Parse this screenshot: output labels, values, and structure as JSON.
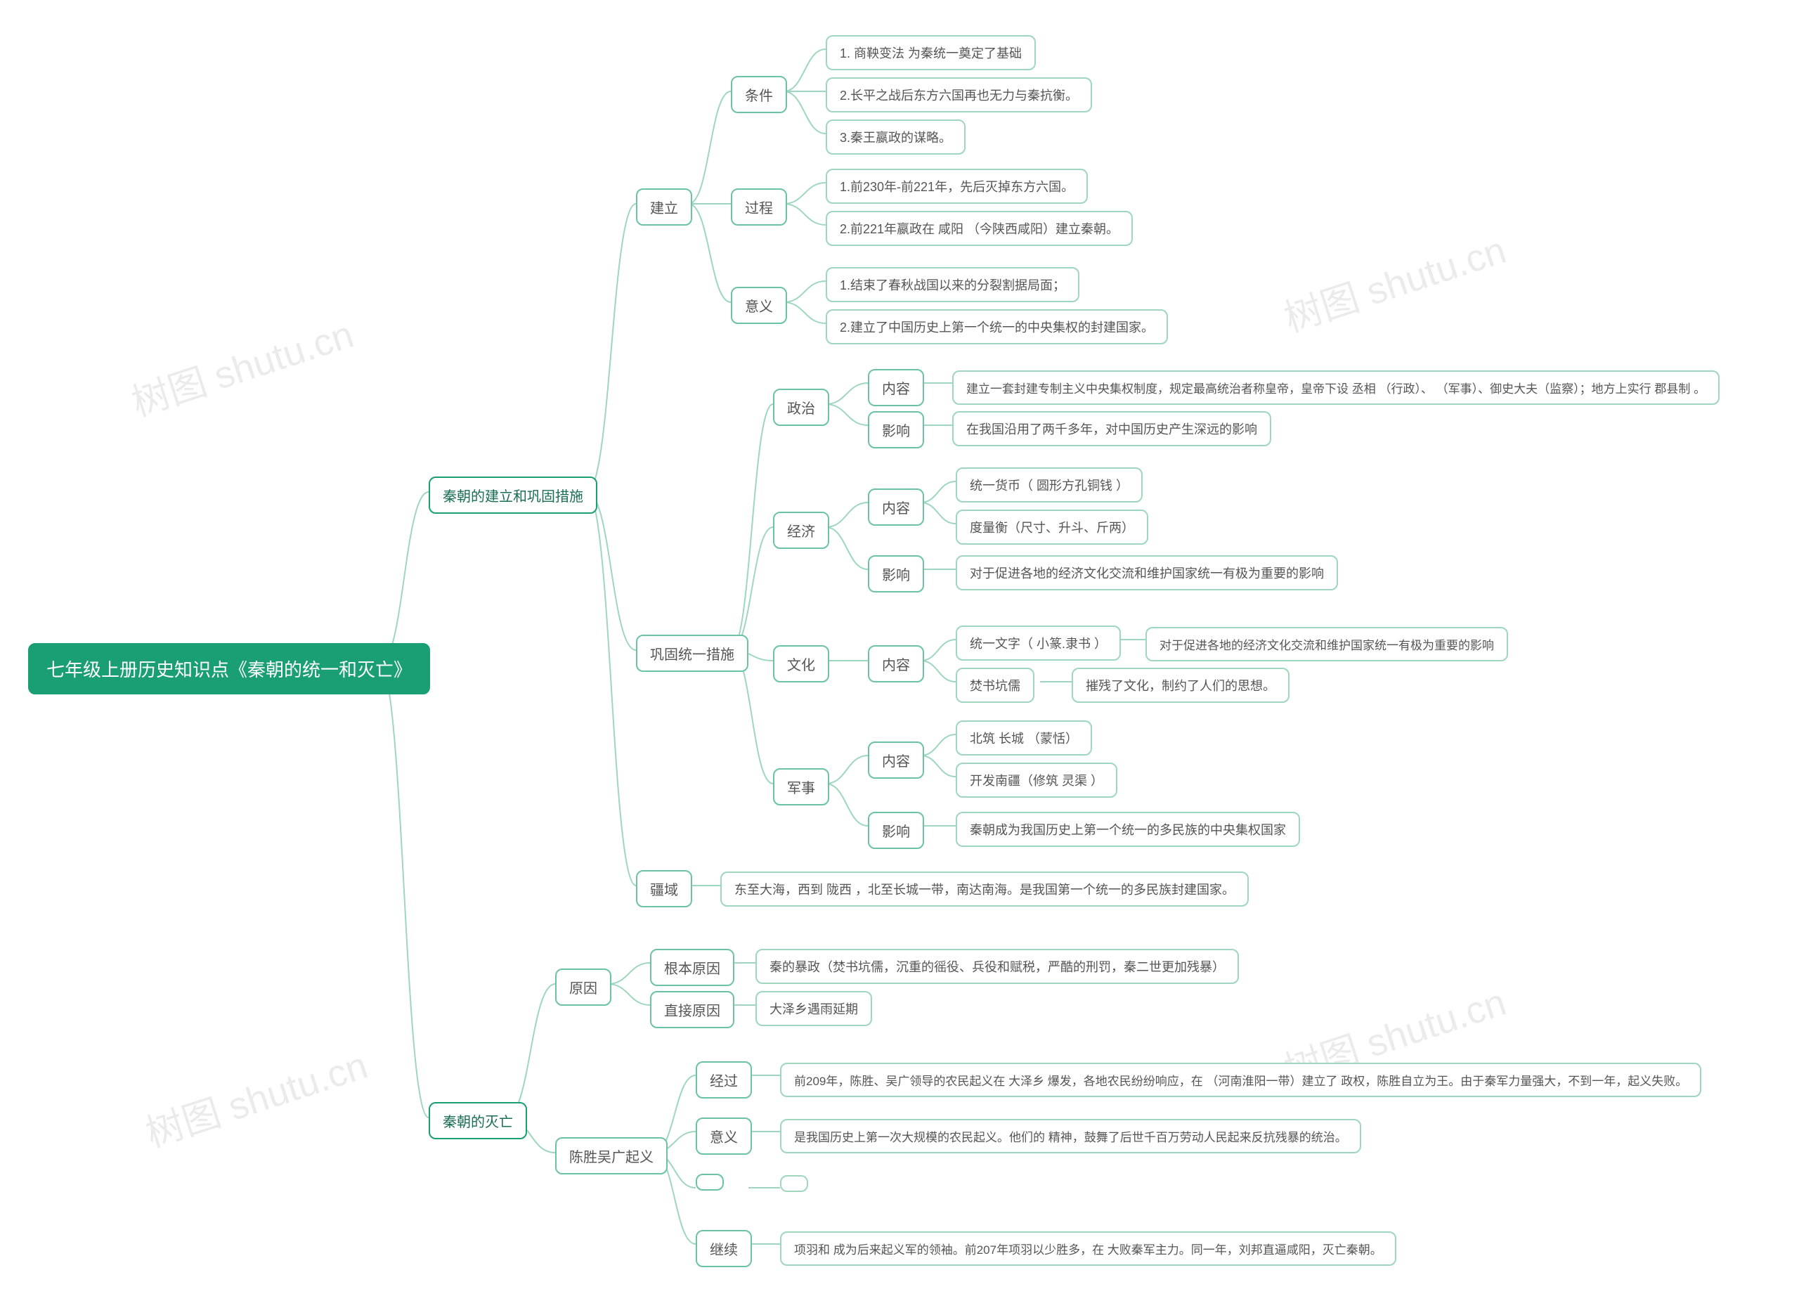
{
  "watermark": "树图 shutu.cn",
  "root": "七年级上册历史知识点《秦朝的统一和灭亡》",
  "b1": "秦朝的建立和巩固措施",
  "b2": "秦朝的灭亡",
  "jl": "建立",
  "tj": "条件",
  "tj1": "1. 商鞅变法 为秦统一奠定了基础",
  "tj2": "2.长平之战后东方六国再也无力与秦抗衡。",
  "tj3": "3.秦王嬴政的谋略。",
  "gc": "过程",
  "gc1": "1.前230年-前221年，先后灭掉东方六国。",
  "gc2": "2.前221年嬴政在 咸阳 （今陕西咸阳）建立秦朝。",
  "yy": "意义",
  "yy1": "1.结束了春秋战国以来的分裂割据局面；",
  "yy2": "2.建立了中国历史上第一个统一的中央集权的封建国家。",
  "gg": "巩固统一措施",
  "zz": "政治",
  "zz_nr": "内容",
  "zz_nr_t": "建立一套封建专制主义中央集权制度，规定最高统治者称皇帝，皇帝下设 丞相 （行政）、 （军事）、御史大夫（监察）；地方上实行 郡县制 。",
  "zz_yx": "影响",
  "zz_yx_t": "在我国沿用了两千多年，对中国历史产生深远的影响",
  "jj": "经济",
  "jj_nr": "内容",
  "jj_nr1": "统一货币（ 圆形方孔铜钱 ）",
  "jj_nr2": "度量衡（尺寸、升斗、斤两）",
  "jj_yx": "影响",
  "jj_yx_t": "对于促进各地的经济文化交流和维护国家统一有极为重要的影响",
  "wh": "文化",
  "wh_nr": "内容",
  "wh_nr1": "统一文字（ 小篆.隶书 ）",
  "wh_nr1_t": "对于促进各地的经济文化交流和维护国家统一有极为重要的影响",
  "wh_nr2": "焚书坑儒",
  "wh_nr2_t": "摧残了文化，制约了人们的思想。",
  "js": "军事",
  "js_nr": "内容",
  "js_nr1": "北筑 长城   （蒙恬）",
  "js_nr2": "开发南疆（修筑 灵渠  ）",
  "js_yx": "影响",
  "js_yx_t": "秦朝成为我国历史上第一个统一的多民族的中央集权国家",
  "jy": "疆域",
  "jy_t": "东至大海，西到 陇西 ，北至长城一带，南达南海。是我国第一个统一的多民族封建国家。",
  "mw_yy": "原因",
  "mw_gb": "根本原因",
  "mw_gb_t": "秦的暴政（焚书坑儒，沉重的徭役、兵役和赋税，严酷的刑罚，秦二世更加残暴）",
  "mw_zj": "直接原因",
  "mw_zj_t": "大泽乡遇雨延期",
  "csw": "陈胜吴广起义",
  "csw_jg": "经过",
  "csw_jg_t": "前209年，陈胜、吴广领导的农民起义在 大泽乡  爆发，各地农民纷纷响应，在  （河南淮阳一带）建立了  政权，陈胜自立为王。由于秦军力量强大，不到一年，起义失败。",
  "csw_yy": "意义",
  "csw_yy_t": "是我国历史上第一次大规模的农民起义。他们的   精神，鼓舞了后世千百万劳动人民起来反抗残暴的统治。",
  "csw_jx": "继续",
  "csw_jx_t": "项羽和   成为后来起义军的领袖。前207年项羽以少胜多，在    大败秦军主力。同一年，刘邦直逼咸阳，灭亡秦朝。",
  "chart_data": {
    "type": "tree",
    "root": "七年级上册历史知识点《秦朝的统一和灭亡》",
    "children": [
      {
        "label": "秦朝的建立和巩固措施",
        "children": [
          {
            "label": "建立",
            "children": [
              {
                "label": "条件",
                "children": [
                  {
                    "label": "1. 商鞅变法 为秦统一奠定了基础"
                  },
                  {
                    "label": "2.长平之战后东方六国再也无力与秦抗衡。"
                  },
                  {
                    "label": "3.秦王嬴政的谋略。"
                  }
                ]
              },
              {
                "label": "过程",
                "children": [
                  {
                    "label": "1.前230年-前221年，先后灭掉东方六国。"
                  },
                  {
                    "label": "2.前221年嬴政在 咸阳 （今陕西咸阳）建立秦朝。"
                  }
                ]
              },
              {
                "label": "意义",
                "children": [
                  {
                    "label": "1.结束了春秋战国以来的分裂割据局面；"
                  },
                  {
                    "label": "2.建立了中国历史上第一个统一的中央集权的封建国家。"
                  }
                ]
              }
            ]
          },
          {
            "label": "巩固统一措施",
            "children": [
              {
                "label": "政治",
                "children": [
                  {
                    "label": "内容",
                    "children": [
                      {
                        "label": "建立一套封建专制主义中央集权制度，规定最高统治者称皇帝，皇帝下设 丞相 （行政）、 （军事）、御史大夫（监察）；地方上实行 郡县制 。"
                      }
                    ]
                  },
                  {
                    "label": "影响",
                    "children": [
                      {
                        "label": "在我国沿用了两千多年，对中国历史产生深远的影响"
                      }
                    ]
                  }
                ]
              },
              {
                "label": "经济",
                "children": [
                  {
                    "label": "内容",
                    "children": [
                      {
                        "label": "统一货币（ 圆形方孔铜钱 ）"
                      },
                      {
                        "label": "度量衡（尺寸、升斗、斤两）"
                      }
                    ]
                  },
                  {
                    "label": "影响",
                    "children": [
                      {
                        "label": "对于促进各地的经济文化交流和维护国家统一有极为重要的影响"
                      }
                    ]
                  }
                ]
              },
              {
                "label": "文化",
                "children": [
                  {
                    "label": "内容",
                    "children": [
                      {
                        "label": "统一文字（ 小篆.隶书 ）",
                        "children": [
                          {
                            "label": "对于促进各地的经济文化交流和维护国家统一有极为重要的影响"
                          }
                        ]
                      },
                      {
                        "label": "焚书坑儒",
                        "children": [
                          {
                            "label": "摧残了文化，制约了人们的思想。"
                          }
                        ]
                      }
                    ]
                  }
                ]
              },
              {
                "label": "军事",
                "children": [
                  {
                    "label": "内容",
                    "children": [
                      {
                        "label": "北筑 长城   （蒙恬）"
                      },
                      {
                        "label": "开发南疆（修筑 灵渠  ）"
                      }
                    ]
                  },
                  {
                    "label": "影响",
                    "children": [
                      {
                        "label": "秦朝成为我国历史上第一个统一的多民族的中央集权国家"
                      }
                    ]
                  }
                ]
              }
            ]
          },
          {
            "label": "疆域",
            "children": [
              {
                "label": "东至大海，西到 陇西 ，北至长城一带，南达南海。是我国第一个统一的多民族封建国家。"
              }
            ]
          }
        ]
      },
      {
        "label": "秦朝的灭亡",
        "children": [
          {
            "label": "原因",
            "children": [
              {
                "label": "根本原因",
                "children": [
                  {
                    "label": "秦的暴政（焚书坑儒，沉重的徭役、兵役和赋税，严酷的刑罚，秦二世更加残暴）"
                  }
                ]
              },
              {
                "label": "直接原因",
                "children": [
                  {
                    "label": "大泽乡遇雨延期"
                  }
                ]
              }
            ]
          },
          {
            "label": "陈胜吴广起义",
            "children": [
              {
                "label": "经过",
                "children": [
                  {
                    "label": "前209年，陈胜、吴广领导的农民起义在 大泽乡  爆发，各地农民纷纷响应，在  （河南淮阳一带）建立了  政权，陈胜自立为王。由于秦军力量强大，不到一年，起义失败。"
                  }
                ]
              },
              {
                "label": "意义",
                "children": [
                  {
                    "label": "是我国历史上第一次大规模的农民起义。他们的   精神，鼓舞了后世千百万劳动人民起来反抗残暴的统治。"
                  }
                ]
              },
              {
                "label": "继续",
                "children": [
                  {
                    "label": "项羽和   成为后来起义军的领袖。前207年项羽以少胜多，在    大败秦军主力。同一年，刘邦直逼咸阳，灭亡秦朝。"
                  }
                ]
              }
            ]
          }
        ]
      }
    ]
  }
}
